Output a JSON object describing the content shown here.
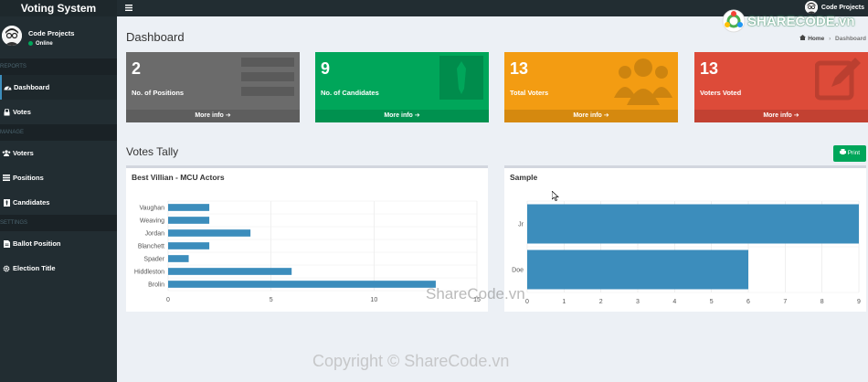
{
  "app": {
    "brand": "Voting System"
  },
  "user": {
    "name": "Code Projects",
    "status": "Online"
  },
  "sidebar": {
    "sections": [
      {
        "header": "REPORTS",
        "items": [
          {
            "label": "Dashboard",
            "icon": "dashboard-icon",
            "active": true
          },
          {
            "label": "Votes",
            "icon": "lock-icon"
          }
        ]
      },
      {
        "header": "MANAGE",
        "items": [
          {
            "label": "Voters",
            "icon": "users-icon"
          },
          {
            "label": "Positions",
            "icon": "tasks-icon"
          },
          {
            "label": "Candidates",
            "icon": "black-tie-icon"
          }
        ]
      },
      {
        "header": "SETTINGS",
        "items": [
          {
            "label": "Ballot Position",
            "icon": "file-text-icon"
          },
          {
            "label": "Election Title",
            "icon": "cog-icon"
          }
        ]
      }
    ]
  },
  "page": {
    "title": "Dashboard",
    "breadcrumb_home": "Home",
    "breadcrumb_current": "Dashboard"
  },
  "stats": [
    {
      "value": "2",
      "label": "No. of Positions",
      "more": "More info",
      "color": "#6b6b6b"
    },
    {
      "value": "9",
      "label": "No. of Candidates",
      "more": "More info",
      "color": "#00a65a"
    },
    {
      "value": "13",
      "label": "Total Voters",
      "more": "More info",
      "color": "#f39c12"
    },
    {
      "value": "13",
      "label": "Voters Voted",
      "more": "More info",
      "color": "#dd4b39"
    }
  ],
  "tally": {
    "title": "Votes Tally",
    "print_label": "Print"
  },
  "chart_data": [
    {
      "type": "bar",
      "orientation": "horizontal",
      "title": "Best Villian - MCU Actors",
      "categories": [
        "Vaughan",
        "Weaving",
        "Jordan",
        "Blanchett",
        "Spader",
        "Hiddleston",
        "Brolin"
      ],
      "values": [
        2,
        2,
        4,
        2,
        1,
        6,
        13
      ],
      "xlim": [
        0,
        15
      ],
      "xticks": [
        0,
        5,
        10,
        15
      ],
      "grid": true,
      "color": "#3c8dbc"
    },
    {
      "type": "bar",
      "orientation": "horizontal",
      "title": "Sample",
      "categories": [
        "Jr",
        "Doe"
      ],
      "values": [
        9,
        6
      ],
      "xlim": [
        0,
        9
      ],
      "xticks": [
        0,
        1,
        2,
        3,
        4,
        5,
        6,
        7,
        8,
        9
      ],
      "grid": true,
      "color": "#3c8dbc"
    }
  ],
  "watermarks": {
    "logo": "SHARECODE.vn",
    "center": "ShareCode.vn",
    "bottom": "Copyright © ShareCode.vn"
  }
}
